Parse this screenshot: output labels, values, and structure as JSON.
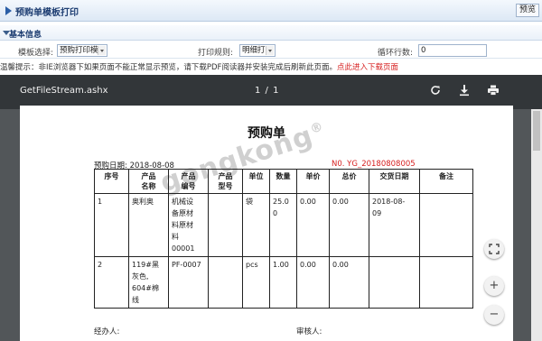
{
  "header": {
    "title": "预购单模板打印",
    "preview_button": "预览"
  },
  "section": {
    "title": "基本信息"
  },
  "form": {
    "template_label": "模板选择:",
    "template_value": "预购打印模",
    "rule_label": "打印规则:",
    "rule_value": "明细打",
    "loop_label": "循环行数:",
    "loop_value": "0"
  },
  "tip": {
    "text": "温馨提示：非IE浏览器下如果页面不能正常显示预览，请下载PDF阅读器并安装完成后刷新此页面。",
    "link": "点此进入下载页面"
  },
  "viewer": {
    "filename": "GetFileStream.ashx",
    "page_indicator": "1 / 1",
    "icons": [
      "rotate-icon",
      "download-icon",
      "print-icon",
      "fit-page-icon",
      "zoom-in-icon",
      "zoom-out-icon"
    ]
  },
  "document": {
    "title": "预购单",
    "date_label": "预购日期: 2018-08-08",
    "number": "N0. YG_20180808005",
    "watermark": "gongkong®",
    "headers": [
      "序号",
      "产品\n名称",
      "产品\n编号",
      "产品\n型号",
      "单位",
      "数量",
      "单价",
      "总价",
      "交货日期",
      "备注"
    ],
    "rows": [
      [
        "1",
        "奥利奥",
        "机械设\n备原材\n料原材\n料\n00001",
        "",
        "袋",
        "25.0\n0",
        "0.00",
        "0.00",
        "2018-08-\n09",
        ""
      ],
      [
        "2",
        "119#黑\n灰色,\n604#棉\n线",
        "PF-0007",
        "",
        "pcs",
        "1.00",
        "0.00",
        "0.00",
        "",
        ""
      ]
    ],
    "signer_label": "经办人:",
    "reviewer_label": "审核人:"
  }
}
